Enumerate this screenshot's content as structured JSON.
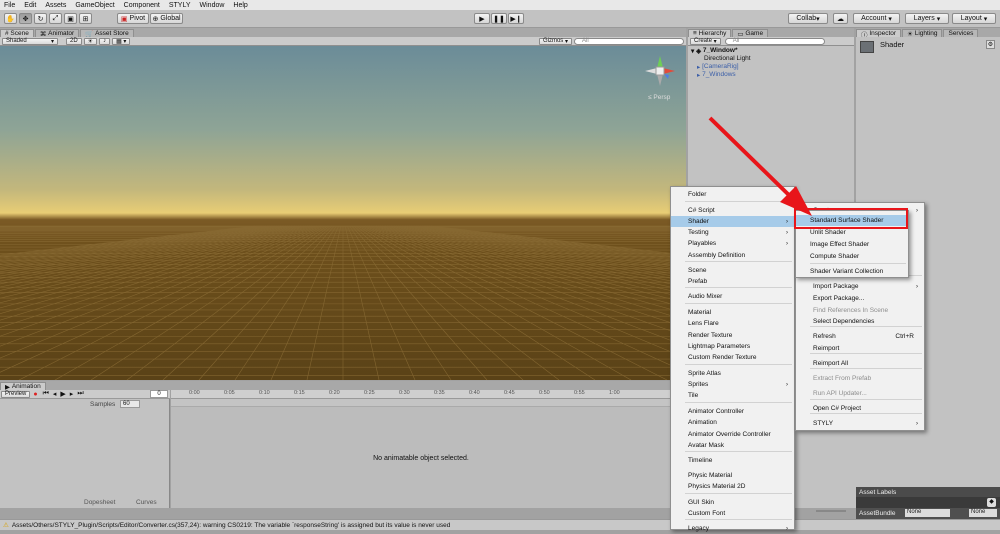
{
  "menubar": [
    "File",
    "Edit",
    "Assets",
    "GameObject",
    "Component",
    "STYLY",
    "Window",
    "Help"
  ],
  "toolbar": {
    "transform_tools": [
      "hand-icon",
      "move-icon",
      "rotate-icon",
      "scale-icon",
      "rect-icon",
      "transform-icon"
    ],
    "pivot": "Pivot",
    "global": "Global",
    "collab": "Collab",
    "account": "Account",
    "layers": "Layers",
    "layout": "Layout"
  },
  "scene_panel": {
    "tabs": [
      "Scene",
      "Animator",
      "Asset Store"
    ],
    "shading": "Shaded",
    "mode_2d": "2D",
    "gizmos": "Gizmos",
    "search_placeholder": "All",
    "persp": "Persp"
  },
  "hierarchy": {
    "tabs": [
      "Hierarchy",
      "Game"
    ],
    "create": "Create",
    "search_placeholder": "All",
    "root": "7_Window*",
    "items": [
      "Directional Light",
      "[CameraRig]",
      "7_Windows"
    ]
  },
  "inspector": {
    "tabs": [
      "Inspector",
      "Lighting",
      "Services"
    ],
    "title": "Shader",
    "asset_labels": "Asset Labels",
    "asset_bundle": "AssetBundle",
    "bundle_value": "None",
    "variant_value": "None"
  },
  "animation": {
    "tab": "Animation",
    "preview": "Preview",
    "samples_label": "Samples",
    "samples_value": "60",
    "ticks": [
      "0:00",
      "0:05",
      "0:10",
      "0:15",
      "0:20",
      "0:25",
      "0:30",
      "0:35",
      "0:40",
      "0:45",
      "0:50",
      "0:55",
      "1:00"
    ],
    "empty_message": "No animatable object selected.",
    "dopesheet": "Dopesheet",
    "curves": "Curves"
  },
  "status_bar": "Assets/Others/STYLY_Plugin/Scripts/Editor/Converter.cs(357,24): warning CS0219: The variable `responseString' is assigned but its value is never used",
  "create_menu": {
    "items": [
      "Folder",
      "C# Script",
      "Shader",
      "Testing",
      "Playables",
      "Assembly Definition",
      "Scene",
      "Prefab",
      "Audio Mixer",
      "Material",
      "Lens Flare",
      "Render Texture",
      "Lightmap Parameters",
      "Custom Render Texture",
      "Sprite Atlas",
      "Sprites",
      "Tile",
      "Animator Controller",
      "Animation",
      "Animator Override Controller",
      "Avatar Mask",
      "Timeline",
      "Physic Material",
      "Physics Material 2D",
      "GUI Skin",
      "Custom Font",
      "Legacy"
    ]
  },
  "context_menu": {
    "items": [
      "Create",
      "Import Package",
      "Export Package...",
      "Find References In Scene",
      "Select Dependencies",
      "Refresh",
      "Reimport",
      "Reimport All",
      "Extract From Prefab",
      "Run API Updater...",
      "Open C# Project",
      "STYLY"
    ],
    "refresh_shortcut": "Ctrl+R"
  },
  "shader_menu": {
    "items": [
      "Standard Surface Shader",
      "Unlit Shader",
      "Image Effect Shader",
      "Compute Shader",
      "Shader Variant Collection"
    ]
  },
  "colors": {
    "highlight_box": "#e8151a",
    "arrow": "#e8151a",
    "menu_highlight": "#a6cbe9"
  }
}
